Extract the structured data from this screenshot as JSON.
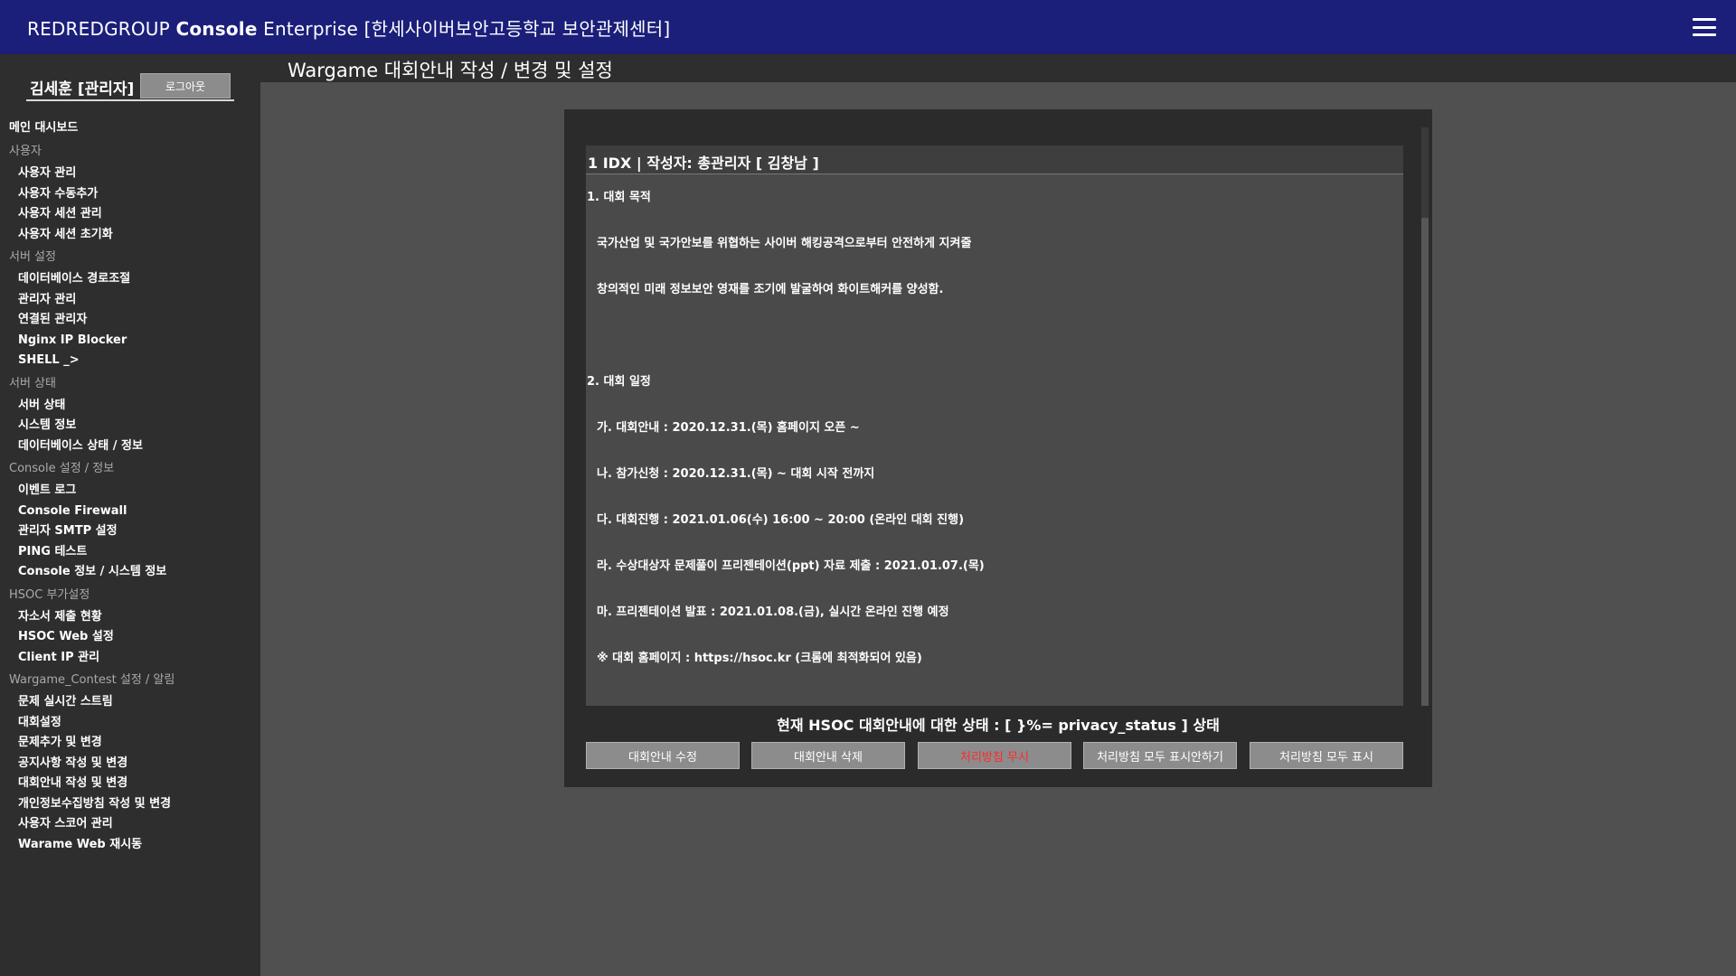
{
  "header": {
    "brand_prefix": "REDREDGROUP ",
    "brand_bold": "Console",
    "brand_suffix": " Enterprise [한세사이버보안고등학교 보안관제센터]",
    "menu_icon": "hamburger-menu-icon"
  },
  "sidebar": {
    "username": "김세훈 [관리자]",
    "logout_label": "로그아웃",
    "dashboard": "메인 대시보드",
    "sections": [
      {
        "title": "사용자",
        "items": [
          "사용자 관리",
          "사용자 수동추가",
          "사용자 세션 관리",
          "사용자 세션 초기화"
        ]
      },
      {
        "title": "서버 설정",
        "items": [
          "데이터베이스 경로조절",
          "관리자 관리",
          "연결된 관리자",
          "Nginx IP Blocker",
          "SHELL _>"
        ]
      },
      {
        "title": "서버 상태",
        "items": [
          "서버 상태",
          "시스템 정보",
          "데이터베이스 상태 / 정보"
        ]
      },
      {
        "title": "Console 설정 / 정보",
        "items": [
          "이벤트 로그",
          "Console Firewall",
          "관리자 SMTP 설정",
          "PING 테스트",
          "Console 정보 / 시스템 정보"
        ]
      },
      {
        "title": "HSOC 부가설정",
        "items": [
          "자소서 제출 현황",
          "HSOC Web 설정",
          "Client IP 관리"
        ]
      },
      {
        "title": "Wargame_Contest 설정 / 알림",
        "items": [
          "문제 실시간 스트림",
          "대회설정",
          "문제추가 및 변경",
          "공지사항 작성 및 변경",
          "대회안내 작성 및 변경",
          "개인정보수집방침 작성 및 변경",
          "사용자 스코어 관리",
          "Warame Web 재시동"
        ]
      }
    ]
  },
  "page": {
    "title": "Wargame 대회안내 작성 / 변경 및 설정"
  },
  "notice": {
    "header": "1 IDX | 작성자: 총관리자 [ 김창남 ]",
    "lines": [
      {
        "text": "1. 대회 목적",
        "style": "heading"
      },
      {
        "text": "국가산업 및 국가안보를 위협하는 사이버 해킹공격으로부터 안전하게 지켜줄",
        "style": "indent"
      },
      {
        "text": "창의적인 미래 정보보안 영재를 조기에 발굴하여 화이트해커를 양성함.",
        "style": "indent"
      },
      {
        "text": "",
        "style": "spacer"
      },
      {
        "text": "2. 대회 일정",
        "style": "heading"
      },
      {
        "text": "가. 대회안내 : 2020.12.31.(목) 홈페이지 오픈 ~",
        "style": "indent"
      },
      {
        "text": "나. 참가신청 : 2020.12.31.(목) ~ 대회 시작 전까지",
        "style": "indent"
      },
      {
        "text": "다. 대회진행 : 2021.01.06(수) 16:00 ~ 20:00 (온라인 대회 진행)",
        "style": "indent"
      },
      {
        "text": "라. 수상대상자 문제풀이 프리젠테이션(ppt) 자료 제출 : 2021.01.07.(목)",
        "style": "indent"
      },
      {
        "text": "마. 프리젠테이션 발표 : 2021.01.08.(금), 실시간 온라인 진행 예정",
        "style": "indent"
      },
      {
        "text": "※ 대회 홈페이지 : https://hsoc.kr  (크롬에 최적화되어 있음)",
        "style": "indent"
      }
    ],
    "status": "현재 HSOC 대회안내에 대한 상태 : [ }%= privacy_status ] 상태"
  },
  "buttons": {
    "edit": "대회안내 수정",
    "delete": "대회안내 삭제",
    "ignore": "처리방침 무시",
    "hide_all": "처리방침 모두 표시안하기",
    "show_all": "처리방침 모두 표시"
  },
  "colors": {
    "header_bg": "#1b1f7a",
    "sidebar_bg": "#2e2e2e",
    "main_bg": "#505050",
    "danger_text": "#ff2a2a"
  }
}
